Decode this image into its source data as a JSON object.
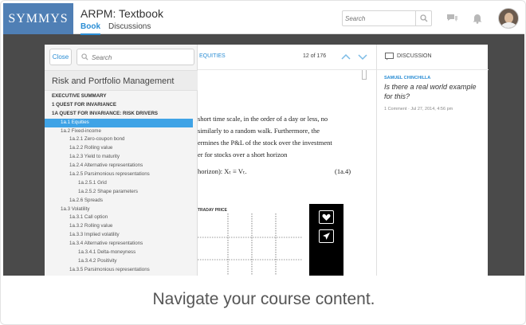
{
  "header": {
    "logo": "SYMMYS",
    "title": "ARPM: Textbook",
    "tabs": [
      {
        "label": "Book",
        "active": true
      },
      {
        "label": "Discussions",
        "active": false
      }
    ],
    "search_placeholder": "Search"
  },
  "toc": {
    "close_label": "Close",
    "search_placeholder": "Search",
    "book_title": "Risk and Portfolio Management",
    "items": [
      {
        "label": "EXECUTIVE SUMMARY",
        "level": 0,
        "bold": true
      },
      {
        "label": "1 QUEST FOR INVARIANCE",
        "level": 0,
        "bold": true
      },
      {
        "label": "1A QUEST FOR INVARIANCE: RISK DRIVERS",
        "level": 0,
        "bold": true
      },
      {
        "label": "1a.1 Equities",
        "level": 1,
        "active": true
      },
      {
        "label": "1a.2 Fixed-income",
        "level": 1
      },
      {
        "label": "1a.2.1 Zero-coupon bond",
        "level": 2
      },
      {
        "label": "1a.2.2 Rolling value",
        "level": 2
      },
      {
        "label": "1a.2.3 Yield to maturity",
        "level": 2
      },
      {
        "label": "1a.2.4 Alternative representations",
        "level": 2
      },
      {
        "label": "1a.2.5 Parsimonious representations",
        "level": 2
      },
      {
        "label": "1a.2.5.1 Grid",
        "level": 3
      },
      {
        "label": "1a.2.5.2 Shape parameters",
        "level": 3
      },
      {
        "label": "1a.2.6 Spreads",
        "level": 2
      },
      {
        "label": "1a.3 Volatility",
        "level": 1
      },
      {
        "label": "1a.3.1 Call option",
        "level": 2
      },
      {
        "label": "1a.3.2 Rolling value",
        "level": 2
      },
      {
        "label": "1a.3.3 Implied volatility",
        "level": 2
      },
      {
        "label": "1a.3.4 Alternative representations",
        "level": 2
      },
      {
        "label": "1a.3.4.1 Delta-moneyness",
        "level": 3
      },
      {
        "label": "1a.3.4.2 Positivity",
        "level": 3
      },
      {
        "label": "1a.3.5 Parsimonious representations",
        "level": 2
      }
    ]
  },
  "reader": {
    "chapter": "EQUITIES",
    "page": "12 of 176",
    "lines": [
      "short time scale, in the order of a day or less, no",
      "similarly to a random walk. Furthermore, the",
      "ermines the P&L of the stock over the investment",
      "er for stocks over a short horizon"
    ],
    "equation": "horizon): Xₜ ≡ Vₜ.",
    "equation_number": "(1a.4)",
    "chart_label": "TRADAY PRICE"
  },
  "discussion": {
    "header": "DISCUSSION",
    "author": "SAMUEL CHINCHILLA",
    "question": "Is there a real world example for this?",
    "meta": "1 Comment · Jul 27, 2014, 4:56 pm"
  },
  "caption": "Navigate your course content.",
  "colors": {
    "logo_bg": "#4f7fb5",
    "accent": "#2a8dd4",
    "active_row": "#3fa3e6",
    "backdrop": "#4a4a4a"
  }
}
